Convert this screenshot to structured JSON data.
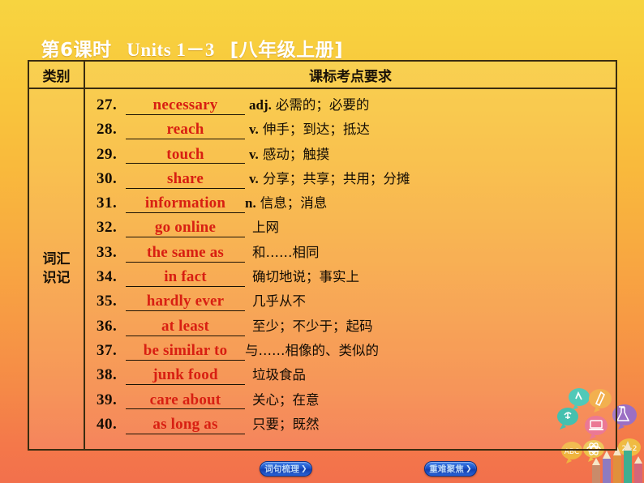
{
  "header": {
    "lesson": "第6课时",
    "units": "Units 1－3",
    "grade": "[八年级上册]",
    "title_full": "第6课时　Units 1－3　[八年级上册]"
  },
  "table": {
    "columns": [
      "类别",
      "课标考点要求"
    ],
    "category_label_line1": "词汇",
    "category_label_line2": "识记",
    "rows": [
      {
        "num": "27.",
        "word": "necessary",
        "pos": "adj.",
        "meaning": "必需的；必要的"
      },
      {
        "num": "28.",
        "word": "reach",
        "pos": "v.",
        "meaning": "伸手；到达；抵达"
      },
      {
        "num": "29.",
        "word": "touch",
        "pos": "v.",
        "meaning": "感动；触摸"
      },
      {
        "num": "30.",
        "word": "share",
        "pos": "v.",
        "meaning": "分享；共享；共用；分摊"
      },
      {
        "num": "31.",
        "word": "information",
        "pos": "n.",
        "meaning": "信息；消息"
      },
      {
        "num": "32.",
        "word": "go online",
        "pos": "",
        "meaning": "上网"
      },
      {
        "num": "33.",
        "word": "the same as",
        "pos": "",
        "meaning": "和……相同"
      },
      {
        "num": "34.",
        "word": "in fact",
        "pos": "",
        "meaning": "确切地说；事实上"
      },
      {
        "num": "35.",
        "word": "hardly ever",
        "pos": "",
        "meaning": "几乎从不"
      },
      {
        "num": "36.",
        "word": "at least",
        "pos": "",
        "meaning": "至少；不少于；起码"
      },
      {
        "num": "37.",
        "word": "be similar to",
        "pos": "",
        "meaning": "与……相像的、类似的"
      },
      {
        "num": "38.",
        "word": "junk food",
        "pos": "",
        "meaning": "垃圾食品"
      },
      {
        "num": "39.",
        "word": "care about",
        "pos": "",
        "meaning": "关心；在意"
      },
      {
        "num": "40.",
        "word": "as long as",
        "pos": "",
        "meaning": "只要；既然"
      }
    ]
  },
  "footer": {
    "button_left": "词句梳理",
    "button_right": "重难聚焦",
    "chevron": "❯"
  },
  "colors": {
    "answer_red": "#d81f12",
    "text_dark": "#140d04",
    "border": "#3a2c10",
    "button_blue": "#1c51c8",
    "bg_top": "#f7d440",
    "bg_bottom": "#f2704c"
  }
}
